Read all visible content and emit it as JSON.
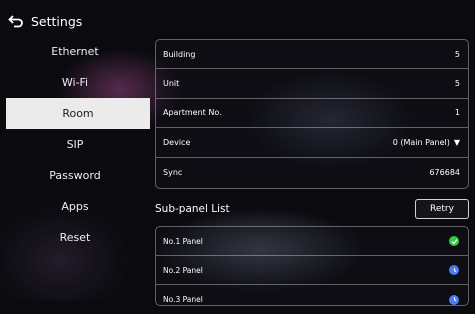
{
  "header": {
    "title": "Settings"
  },
  "sidebar": {
    "items": [
      {
        "label": "Ethernet"
      },
      {
        "label": "Wi-Fi"
      },
      {
        "label": "Room"
      },
      {
        "label": "SIP"
      },
      {
        "label": "Password"
      },
      {
        "label": "Apps"
      },
      {
        "label": "Reset"
      }
    ],
    "selected": "Room"
  },
  "room": {
    "rows": [
      {
        "label": "Building",
        "value": "5"
      },
      {
        "label": "Unit",
        "value": "5"
      },
      {
        "label": "Apartment No.",
        "value": "1"
      },
      {
        "label": "Device",
        "value": "0 (Main Panel)"
      },
      {
        "label": "Sync",
        "value": "676684"
      }
    ]
  },
  "subpanel": {
    "title": "Sub-panel List",
    "retry_label": "Retry",
    "items": [
      {
        "label": "No.1 Panel",
        "status": "connected",
        "icon": "check-circle-icon",
        "color": "#2ecc40"
      },
      {
        "label": "No.2 Panel",
        "status": "pending",
        "icon": "clock-icon",
        "color": "#4a7cf0"
      },
      {
        "label": "No.3 Panel",
        "status": "pending",
        "icon": "clock-icon",
        "color": "#4a7cf0"
      }
    ]
  }
}
